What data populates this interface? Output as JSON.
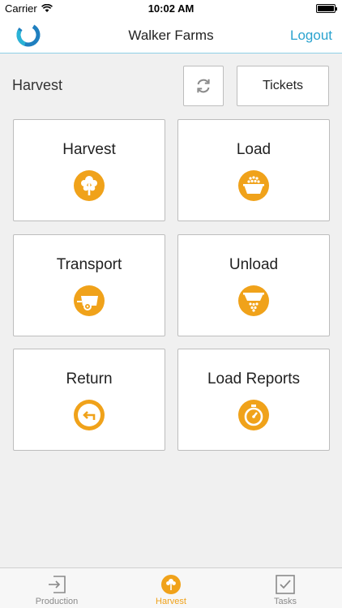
{
  "status_bar": {
    "carrier": "Carrier",
    "time": "10:02 AM"
  },
  "nav": {
    "title": "Walker Farms",
    "logout_label": "Logout"
  },
  "page": {
    "section_title": "Harvest",
    "tickets_label": "Tickets",
    "refresh_icon": "refresh-icon"
  },
  "tiles": [
    {
      "label": "Harvest",
      "icon": "tree-icon"
    },
    {
      "label": "Load",
      "icon": "load-bin-icon"
    },
    {
      "label": "Transport",
      "icon": "cart-icon"
    },
    {
      "label": "Unload",
      "icon": "unload-bin-icon"
    },
    {
      "label": "Return",
      "icon": "return-icon"
    },
    {
      "label": "Load Reports",
      "icon": "stopwatch-icon"
    }
  ],
  "tab_bar": {
    "items": [
      {
        "label": "Production",
        "icon": "login-arrow-icon",
        "active": false
      },
      {
        "label": "Harvest",
        "icon": "tree-icon",
        "active": true
      },
      {
        "label": "Tasks",
        "icon": "checkbox-icon",
        "active": false
      }
    ]
  },
  "colors": {
    "accent": "#f0a21a",
    "link": "#2aa3cf",
    "background": "#f0f0f0",
    "border": "#bdbdbd"
  }
}
